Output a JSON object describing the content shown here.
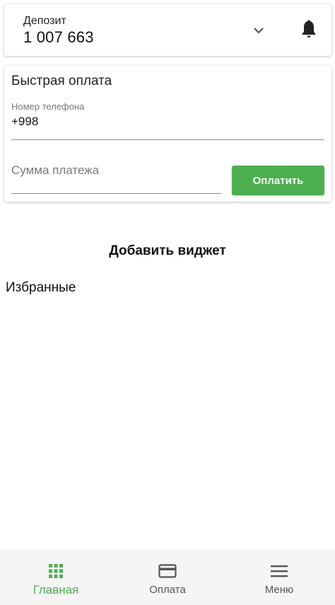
{
  "account": {
    "name": "Депозит",
    "balance": "1 007 663"
  },
  "quick_payment": {
    "title": "Быстрая оплата",
    "phone_label": "Номер телефона",
    "phone_value": "+998",
    "amount_placeholder": "Сумма платежа",
    "amount_value": "",
    "pay_button": "Оплатить"
  },
  "widgets": {
    "add_widget": "Добавить виджет",
    "favorites_title": "Избранные"
  },
  "bottom_nav": {
    "items": [
      {
        "label": "Главная",
        "icon": "grid-icon",
        "active": true
      },
      {
        "label": "Оплата",
        "icon": "card-icon",
        "active": false
      },
      {
        "label": "Меню",
        "icon": "hamburger-menu-icon",
        "active": false
      }
    ]
  },
  "colors": {
    "accent": "#4caf50",
    "inactive": "#555555"
  }
}
